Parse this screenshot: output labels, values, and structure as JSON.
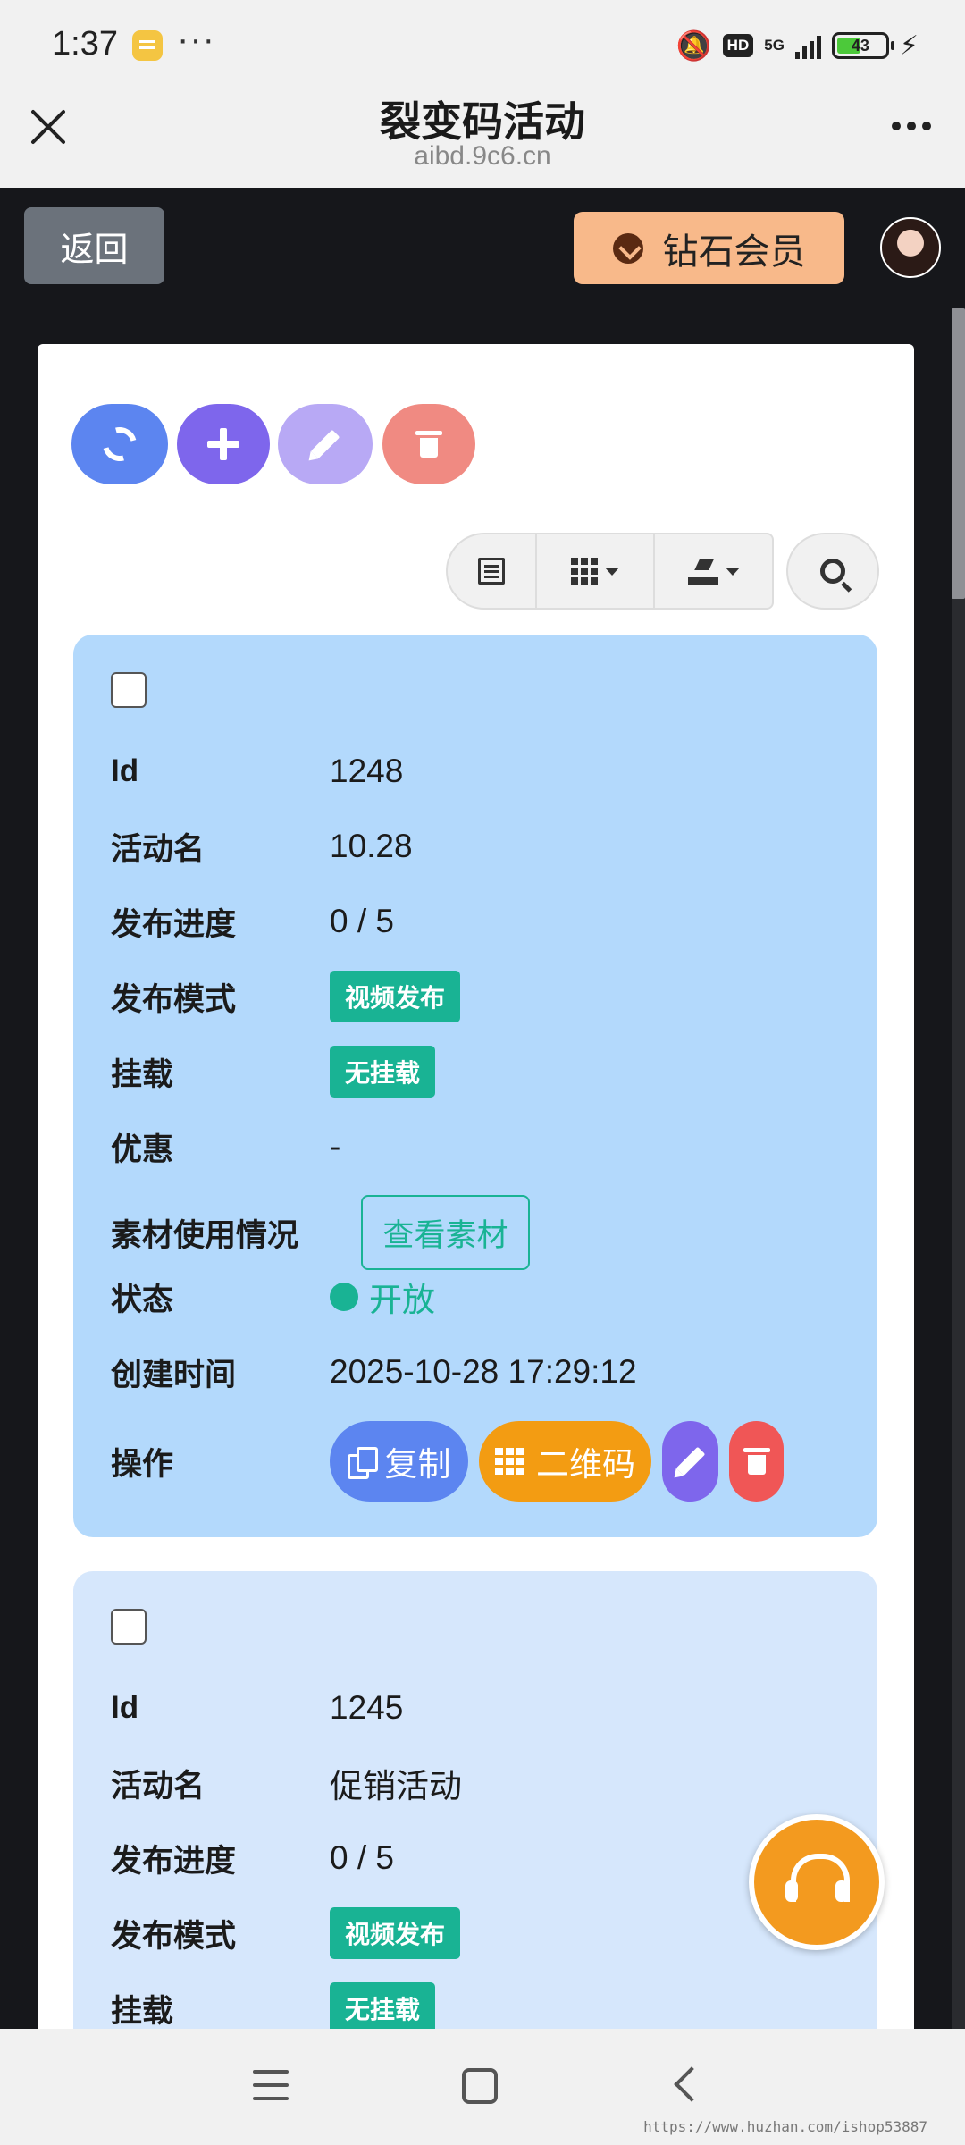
{
  "status_bar": {
    "time": "1:37",
    "network": "5G",
    "hd": "HD",
    "battery": "43",
    "dots": "···"
  },
  "titlebar": {
    "title": "裂变码活动",
    "subtitle": "aibd.9c6.cn"
  },
  "header": {
    "back_label": "返回",
    "vip_label": "钻石会员"
  },
  "colors": {
    "primary": "#5c85f0",
    "purple": "#7e66ec",
    "teal": "#19b394",
    "orange": "#f39c12",
    "red": "#f05656",
    "card_active": "#b3d9fc",
    "card": "#d6e7fc"
  },
  "toolbar": {
    "icons": [
      "refresh-icon",
      "plus-icon",
      "pencil-icon",
      "trash-icon"
    ],
    "group_icons": [
      "list-icon",
      "grid-icon",
      "export-icon"
    ],
    "search_icon": "search-icon"
  },
  "labels": {
    "id": "Id",
    "name": "活动名",
    "progress": "发布进度",
    "mode": "发布模式",
    "mount": "挂载",
    "discount": "优惠",
    "material": "素材使用情况",
    "status": "状态",
    "created": "创建时间",
    "actions": "操作"
  },
  "actions": {
    "copy": "复制",
    "qrcode": "二维码"
  },
  "records": [
    {
      "id": "1248",
      "name": "10.28",
      "progress": "0 / 5",
      "mode": "视频发布",
      "mount": "无挂载",
      "discount": "-",
      "material_button": "查看素材",
      "status": "开放",
      "created": "2025-10-28 17:29:12"
    },
    {
      "id": "1245",
      "name": "促销活动",
      "progress": "0 / 5",
      "mode": "视频发布",
      "mount": "无挂载"
    }
  ],
  "watermark": "https://www.huzhan.com/ishop53887"
}
